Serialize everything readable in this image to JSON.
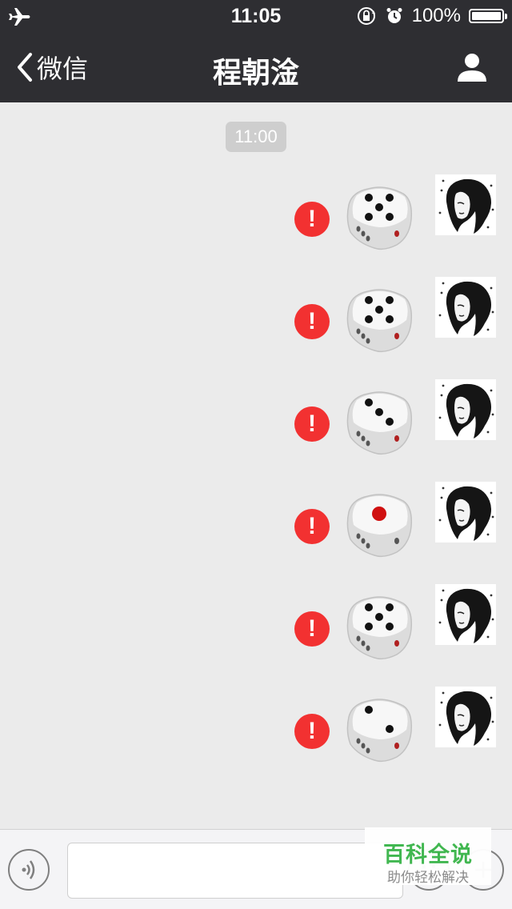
{
  "status_bar": {
    "time": "11:05",
    "battery_percent": "100%",
    "battery_level": 1.0,
    "icons": [
      "airplane-icon",
      "rotation-lock-icon",
      "alarm-icon",
      "battery-icon"
    ]
  },
  "nav": {
    "back_label": "微信",
    "title": "程朝淦",
    "right_icon": "person-icon"
  },
  "chat": {
    "timestamp": "11:00",
    "messages": [
      {
        "type": "dice",
        "face": 5,
        "status": "failed",
        "error_mark": "!"
      },
      {
        "type": "dice",
        "face": 5,
        "status": "failed",
        "error_mark": "!"
      },
      {
        "type": "dice",
        "face": 3,
        "status": "failed",
        "error_mark": "!"
      },
      {
        "type": "dice",
        "face": 1,
        "status": "failed",
        "error_mark": "!"
      },
      {
        "type": "dice",
        "face": 5,
        "status": "failed",
        "error_mark": "!"
      },
      {
        "type": "dice",
        "face": 2,
        "status": "failed",
        "error_mark": "!"
      }
    ]
  },
  "input_bar": {
    "icons": [
      "voice-icon",
      "emoji-icon",
      "add-icon"
    ]
  },
  "watermark": {
    "title": "百科全说",
    "subtitle": "助你轻松解决"
  },
  "colors": {
    "nav_bg": "#2e2e32",
    "chat_bg": "#ebebeb",
    "error_red": "#f23131",
    "watermark_green": "#3ab54a"
  }
}
